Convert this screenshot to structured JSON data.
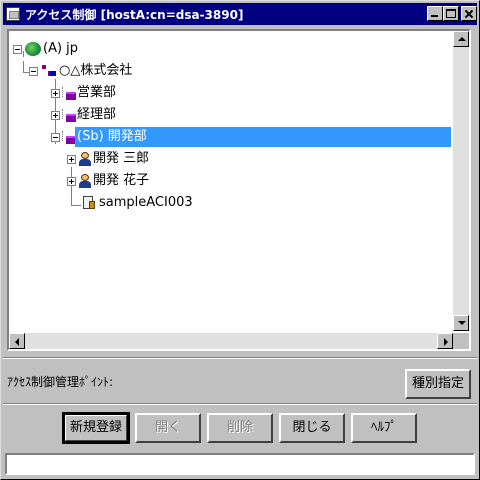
{
  "window": {
    "title": "アクセス制御 [hostA:cn=dsa-3890]"
  },
  "tree": {
    "nodes": [
      {
        "label": "(A) jp",
        "icon": "globe-icon",
        "expander": "minus"
      },
      {
        "label": "○△株式会社",
        "icon": "organization-icon",
        "expander": "minus"
      },
      {
        "label": "営業部",
        "icon": "department-icon",
        "expander": "plus"
      },
      {
        "label": "経理部",
        "icon": "department-icon",
        "expander": "plus"
      },
      {
        "label": "(Sb) 開発部",
        "icon": "department-icon",
        "expander": "minus",
        "selected": true
      },
      {
        "label": "開発 三郎",
        "icon": "person-icon",
        "expander": "plus"
      },
      {
        "label": "開発 花子",
        "icon": "person-icon",
        "expander": "plus"
      },
      {
        "label": "sampleACI003",
        "icon": "acl-icon",
        "expander": "none"
      }
    ]
  },
  "access_point": {
    "label": "ｱｸｾｽ制御管理ﾎﾟｲﾝﾄ:"
  },
  "buttons": {
    "type_spec": "種別指定",
    "new_register": "新規登録",
    "open": "開く",
    "delete": "削除",
    "close": "閉じる",
    "help": "ﾍﾙﾌﾟ"
  },
  "status_bar": {
    "text": ""
  },
  "colors": {
    "title_bar": "#000080",
    "selection": "#3399ff",
    "face": "#c0c0c0"
  }
}
